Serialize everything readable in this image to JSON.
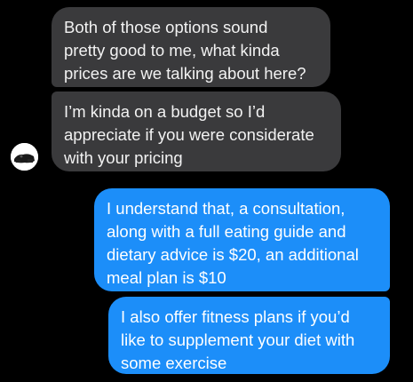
{
  "conversation": {
    "messages": [
      {
        "direction": "incoming",
        "text": "Both of those options sound\npretty good to me, what kinda\nprices are we talking about here?"
      },
      {
        "direction": "incoming",
        "text": "I’m kinda on a budget so I’d\nappreciate if you were considerate\nwith your pricing"
      },
      {
        "direction": "outgoing",
        "text": "I understand that, a consultation,\nalong with a full eating guide and\ndietary advice is $20, an additional\nmeal plan is $10"
      },
      {
        "direction": "outgoing",
        "text": "I also offer fitness plans if you’d\nlike to supplement your diet with\nsome exercise"
      }
    ],
    "avatar_icon": "user-avatar-icon"
  },
  "colors": {
    "background": "#000000",
    "incoming_bubble": "#3a3a3c",
    "outgoing_bubble": "#1c8ef9"
  }
}
